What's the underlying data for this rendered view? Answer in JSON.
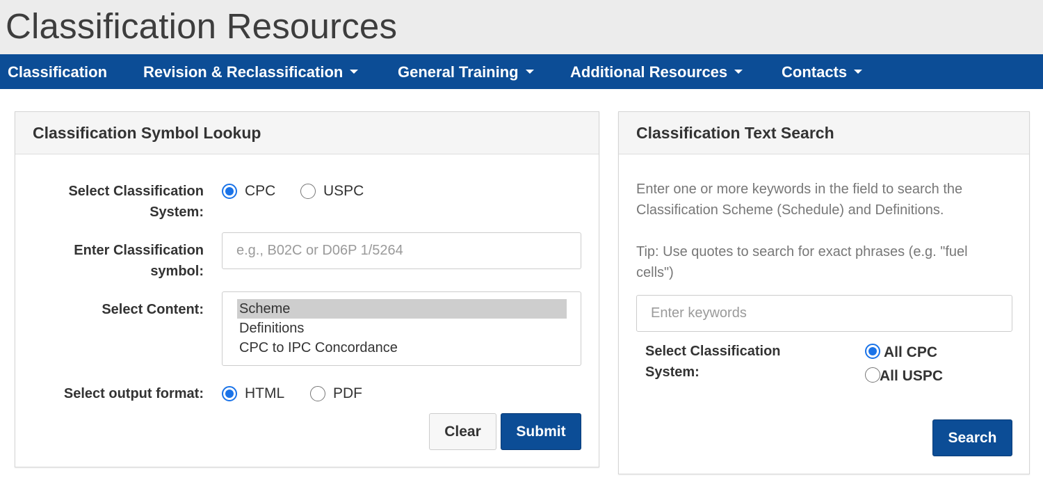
{
  "header": {
    "site_title": "Classification Resources"
  },
  "nav": {
    "items": [
      {
        "label": "Classification",
        "dropdown": false
      },
      {
        "label": "Revision & Reclassification",
        "dropdown": true
      },
      {
        "label": "General Training",
        "dropdown": true
      },
      {
        "label": "Additional Resources",
        "dropdown": true
      },
      {
        "label": "Contacts",
        "dropdown": true
      }
    ]
  },
  "symbol_lookup": {
    "title": "Classification Symbol Lookup",
    "system_label_line1": "Select Classification",
    "system_label_line2": "System:",
    "system_options": [
      "CPC",
      "USPC"
    ],
    "system_selected": "CPC",
    "symbol_label_line1": "Enter Classification",
    "symbol_label_line2": "symbol:",
    "symbol_value": "",
    "symbol_placeholder": "e.g., B02C or D06P 1/5264",
    "content_label": "Select Content:",
    "content_options": [
      "Scheme",
      "Definitions",
      "CPC to IPC Concordance"
    ],
    "content_selected": "Scheme",
    "format_label": "Select output format:",
    "format_options": [
      "HTML",
      "PDF"
    ],
    "format_selected": "HTML",
    "clear_label": "Clear",
    "submit_label": "Submit"
  },
  "text_search": {
    "title": "Classification Text Search",
    "description_line1": "Enter one or more keywords in the field to search the",
    "description_line2": "Classification Scheme (Schedule) and Definitions.",
    "tip_line1": "Tip: Use quotes to search for exact phrases (e.g. \"fuel",
    "tip_line2": "cells\")",
    "keywords_value": "",
    "keywords_placeholder": "Enter keywords",
    "system_label_line1": "Select Classification",
    "system_label_line2": "System:",
    "system_options": [
      "All CPC",
      "All USPC"
    ],
    "system_selected": "All CPC",
    "search_label": "Search"
  },
  "colors": {
    "nav_background": "#0c4d96",
    "primary_button": "#0c4d96",
    "radio_accent": "#1a73e8",
    "title_bar": "#ececec"
  }
}
